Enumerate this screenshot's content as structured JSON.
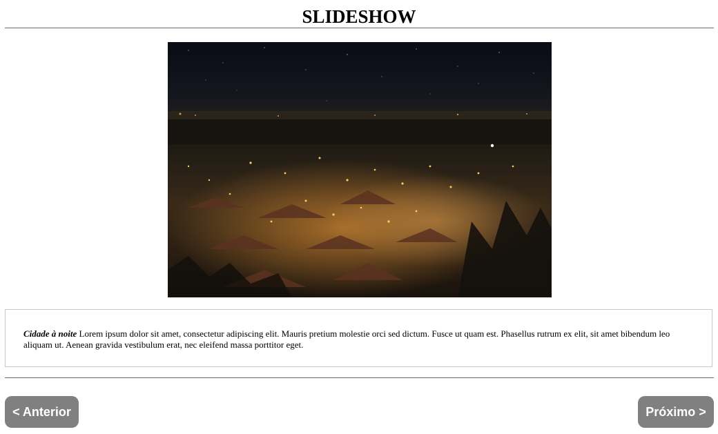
{
  "page": {
    "title": "SLIDESHOW"
  },
  "slide": {
    "caption_title": "Cidade à noite",
    "caption_body": "Lorem ipsum dolor sit amet, consectetur adipiscing elit. Mauris pretium molestie orci sed dictum. Fusce ut quam est. Phasellus rutrum ex elit, sit amet bibendum leo aliquam ut. Aenean gravida vestibulum erat, nec eleifend massa porttitor eget."
  },
  "navigation": {
    "prev_label": "< Anterior",
    "next_label": "Próximo >"
  },
  "colors": {
    "button_bg": "#808080",
    "button_text": "#ffffff",
    "rule": "#6b6b6b",
    "caption_border": "#c8c8c8"
  }
}
